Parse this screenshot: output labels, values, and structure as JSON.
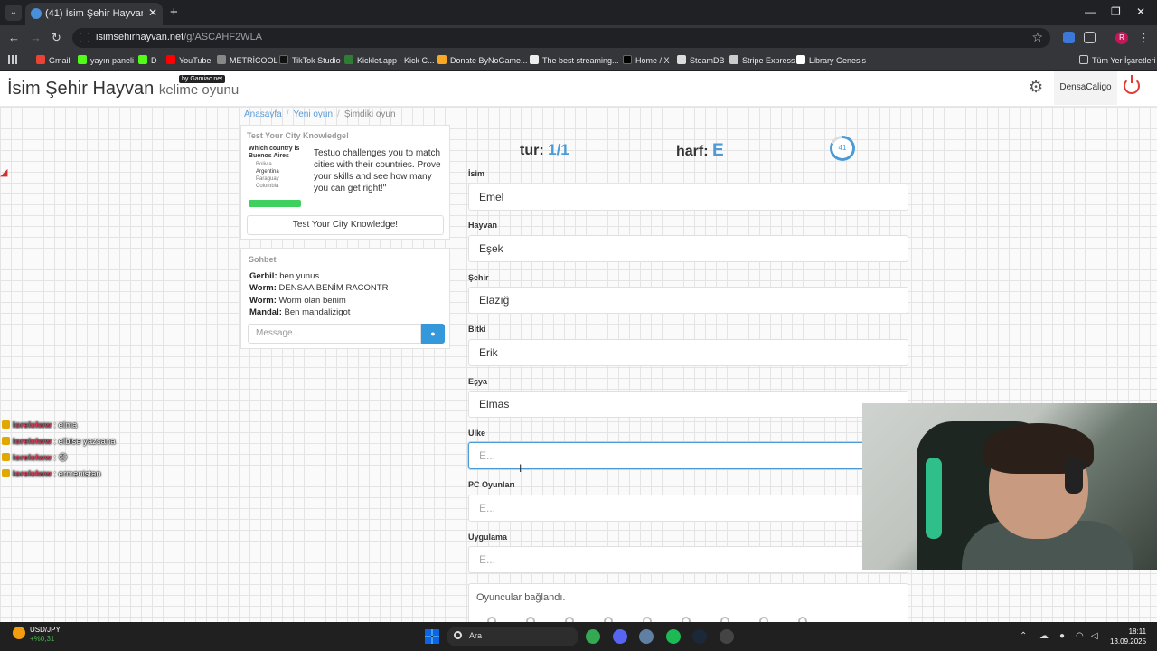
{
  "browser": {
    "tab_title": "(41) İsim Şehir Hayvan oyunu...",
    "url_host": "isimsehirhayvan.net",
    "url_path": "/g/ASCAHF2WLA",
    "bookmarks": [
      "Gmail",
      "yayın paneli",
      "D",
      "YouTube",
      "METRİCOOL",
      "TikTok Studio",
      "Kicklet.app - Kick C...",
      "Donate ByNoGame...",
      "The best streaming...",
      "Home / X",
      "SteamDB",
      "Stripe Express",
      "Library Genesis"
    ],
    "all_bookmarks": "Tüm Yer İşaretleri",
    "profile_initial": "R"
  },
  "site": {
    "logo_main": "İsim Şehir Hayvan",
    "logo_sub": "kelime oyunu",
    "logo_badge": "by Gamiac.net",
    "username": "DensaCaligo"
  },
  "breadcrumb": [
    "Anasayfa",
    "Yeni oyun",
    "Şimdiki oyun"
  ],
  "ad": {
    "title": "Test Your City Knowledge!",
    "thumb_question": "Which country is Buenos Aires",
    "thumb_options": [
      "Bolivia",
      "Argentina",
      "Paraguay",
      "Colombia"
    ],
    "text": "Testuo challenges you to match cities with their countries. Prove your skills and see how many you can get right!\"",
    "button": "Test Your City Knowledge!"
  },
  "chat": {
    "title": "Sohbet",
    "messages": [
      {
        "user": "Gerbil:",
        "text": "ben yunus"
      },
      {
        "user": "Worm:",
        "text": "DENSAA BENİM RACONTR"
      },
      {
        "user": "Worm:",
        "text": "Worm olan benim"
      },
      {
        "user": "Mandal:",
        "text": "Ben mandalizigot"
      }
    ],
    "placeholder": "Message..."
  },
  "twitch_chat": [
    {
      "user": "lorelelww",
      "text": ": elma"
    },
    {
      "user": "lorelelww",
      "text": ": elbise yazsana"
    },
    {
      "user": "lorelelww",
      "text": ": 😅"
    },
    {
      "user": "lorelelww",
      "text": ": ermenistan"
    }
  ],
  "game": {
    "round_label": "tur:",
    "round_value": "1/1",
    "letter_label": "harf:",
    "letter_value": "E",
    "timer": "41",
    "timer_fraction": 0.82,
    "fields": [
      {
        "label": "İsim",
        "value": "Emel"
      },
      {
        "label": "Hayvan",
        "value": "Eşek"
      },
      {
        "label": "Şehir",
        "value": "Elazığ"
      },
      {
        "label": "Bitki",
        "value": "Erik"
      },
      {
        "label": "Eşya",
        "value": "Elmas"
      },
      {
        "label": "Ülke",
        "value": "",
        "placeholder": "E..."
      },
      {
        "label": "PC Oyunları",
        "value": "",
        "placeholder": "E..."
      },
      {
        "label": "Uygulama",
        "value": "",
        "placeholder": "E..."
      }
    ],
    "status": "Oyuncular bağlandı."
  },
  "taskbar": {
    "widget_name": "USD/JPY",
    "widget_value": "+%0,31",
    "search": "Ara",
    "time": "18:11",
    "date": "13.09.2025"
  },
  "colors": {
    "accent": "#4a9bd7",
    "send_button": "#3498db",
    "power": "#e53935"
  }
}
